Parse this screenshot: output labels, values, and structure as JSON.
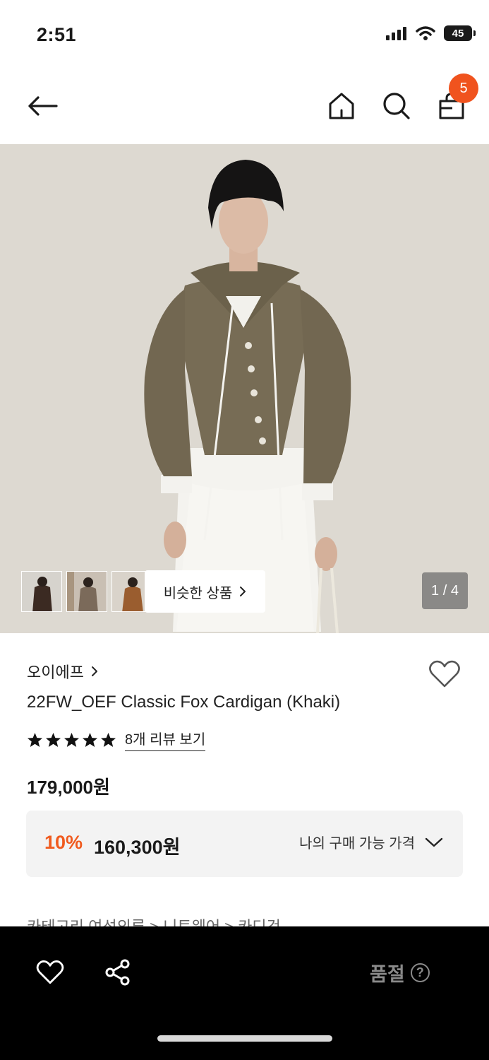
{
  "status_bar": {
    "time": "2:51",
    "battery": "45"
  },
  "header": {
    "icons": [
      "arrow-left-icon",
      "home-icon",
      "search-icon",
      "shopping-bag-icon"
    ],
    "cart_count": "5"
  },
  "gallery": {
    "similar_button_label": "비슷한 상품",
    "page_indicator": "1 / 4",
    "thumbnail_count": 3
  },
  "product": {
    "brand": "오이에프",
    "name": "22FW_OEF Classic Fox Cardigan (Khaki)",
    "rating_stars": 5,
    "review_link": "8개 리뷰 보기",
    "price": "179,000원",
    "discount_rate": "10%",
    "discount_price": "160,300원",
    "my_price_label": "나의 구매 가능 가격",
    "category_path": "카테고리      여성의류  >  니트웨어  >  카디건"
  },
  "bottom_bar": {
    "soldout_label": "품절",
    "help_glyph": "?"
  },
  "colors": {
    "accent": "#f05a1e",
    "badge": "#f0531e",
    "bottom_bar": "#000000",
    "price_box": "#f3f3f3"
  }
}
